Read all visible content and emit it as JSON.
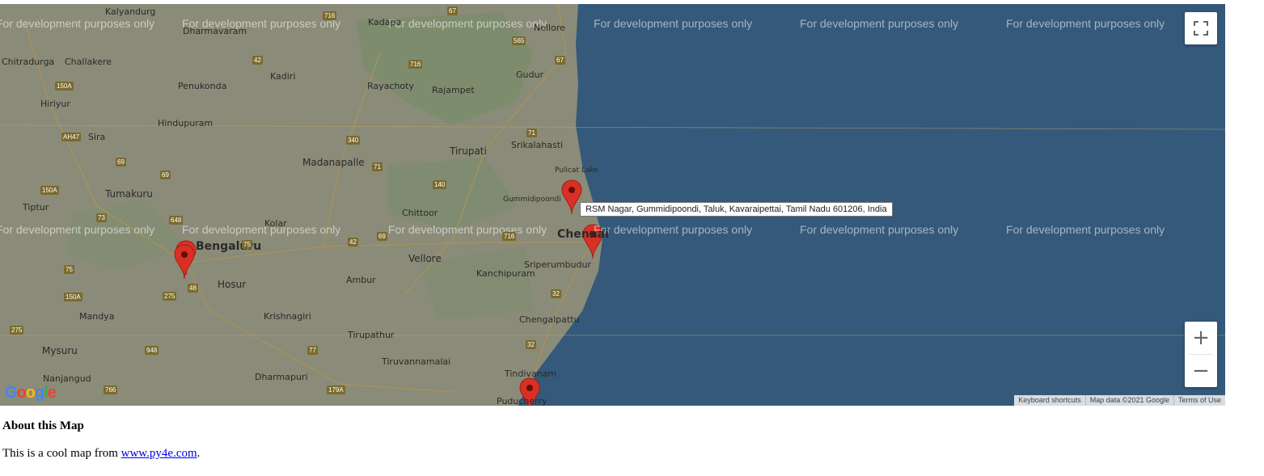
{
  "map": {
    "watermark": "For development purposes only",
    "tooltip": "RSM Nagar, Gummidipoondi, Taluk, Kavaraipettai, Tamil Nadu 601206, India",
    "attribution": {
      "shortcuts": "Keyboard shortcuts",
      "map_data": "Map data ©2021 Google",
      "terms": "Terms of Use"
    },
    "controls": {
      "zoom_in": "+",
      "zoom_out": "−"
    },
    "logo": "Google",
    "colors": {
      "sea": "#34597a",
      "land": "#8a8a78",
      "marker": "#d93025"
    },
    "places": [
      "Kalyandurg",
      "Dharmavaram",
      "Kadapa",
      "Nellore",
      "Chitradurga",
      "Challakere",
      "Kadiri",
      "Gudur",
      "Penukonda",
      "Rayachoty",
      "Rajampet",
      "Hiriyur",
      "Hindupuram",
      "Sira",
      "Srikalahasti",
      "Tirupati",
      "Madanapalle",
      "Pulicat Lake",
      "Gummidipoondi",
      "Tiptur",
      "Tumakuru",
      "Chittoor",
      "Kolar",
      "Chennai",
      "Bengaluru",
      "Vellore",
      "Sriperumbudur",
      "Kanchipuram",
      "Ambur",
      "Hosur",
      "Mandya",
      "Krishnagiri",
      "Chengalpattu",
      "Mysuru",
      "Tirupathur",
      "Tiruvannamalai",
      "Nanjangud",
      "Dharmapuri",
      "Tindivanam",
      "Puducherry"
    ],
    "highways": [
      "67",
      "716",
      "565",
      "67",
      "716",
      "42",
      "150A",
      "AH47",
      "340",
      "71",
      "69",
      "69",
      "71",
      "140",
      "150A",
      "73",
      "648",
      "75",
      "42",
      "69",
      "716",
      "75",
      "150A",
      "275",
      "48",
      "32",
      "948",
      "77",
      "32",
      "275",
      "766",
      "179A"
    ]
  },
  "about": {
    "title": "About this Map",
    "text_prefix": "This is a cool map from ",
    "link": "www.py4e.com",
    "text_suffix": "."
  }
}
